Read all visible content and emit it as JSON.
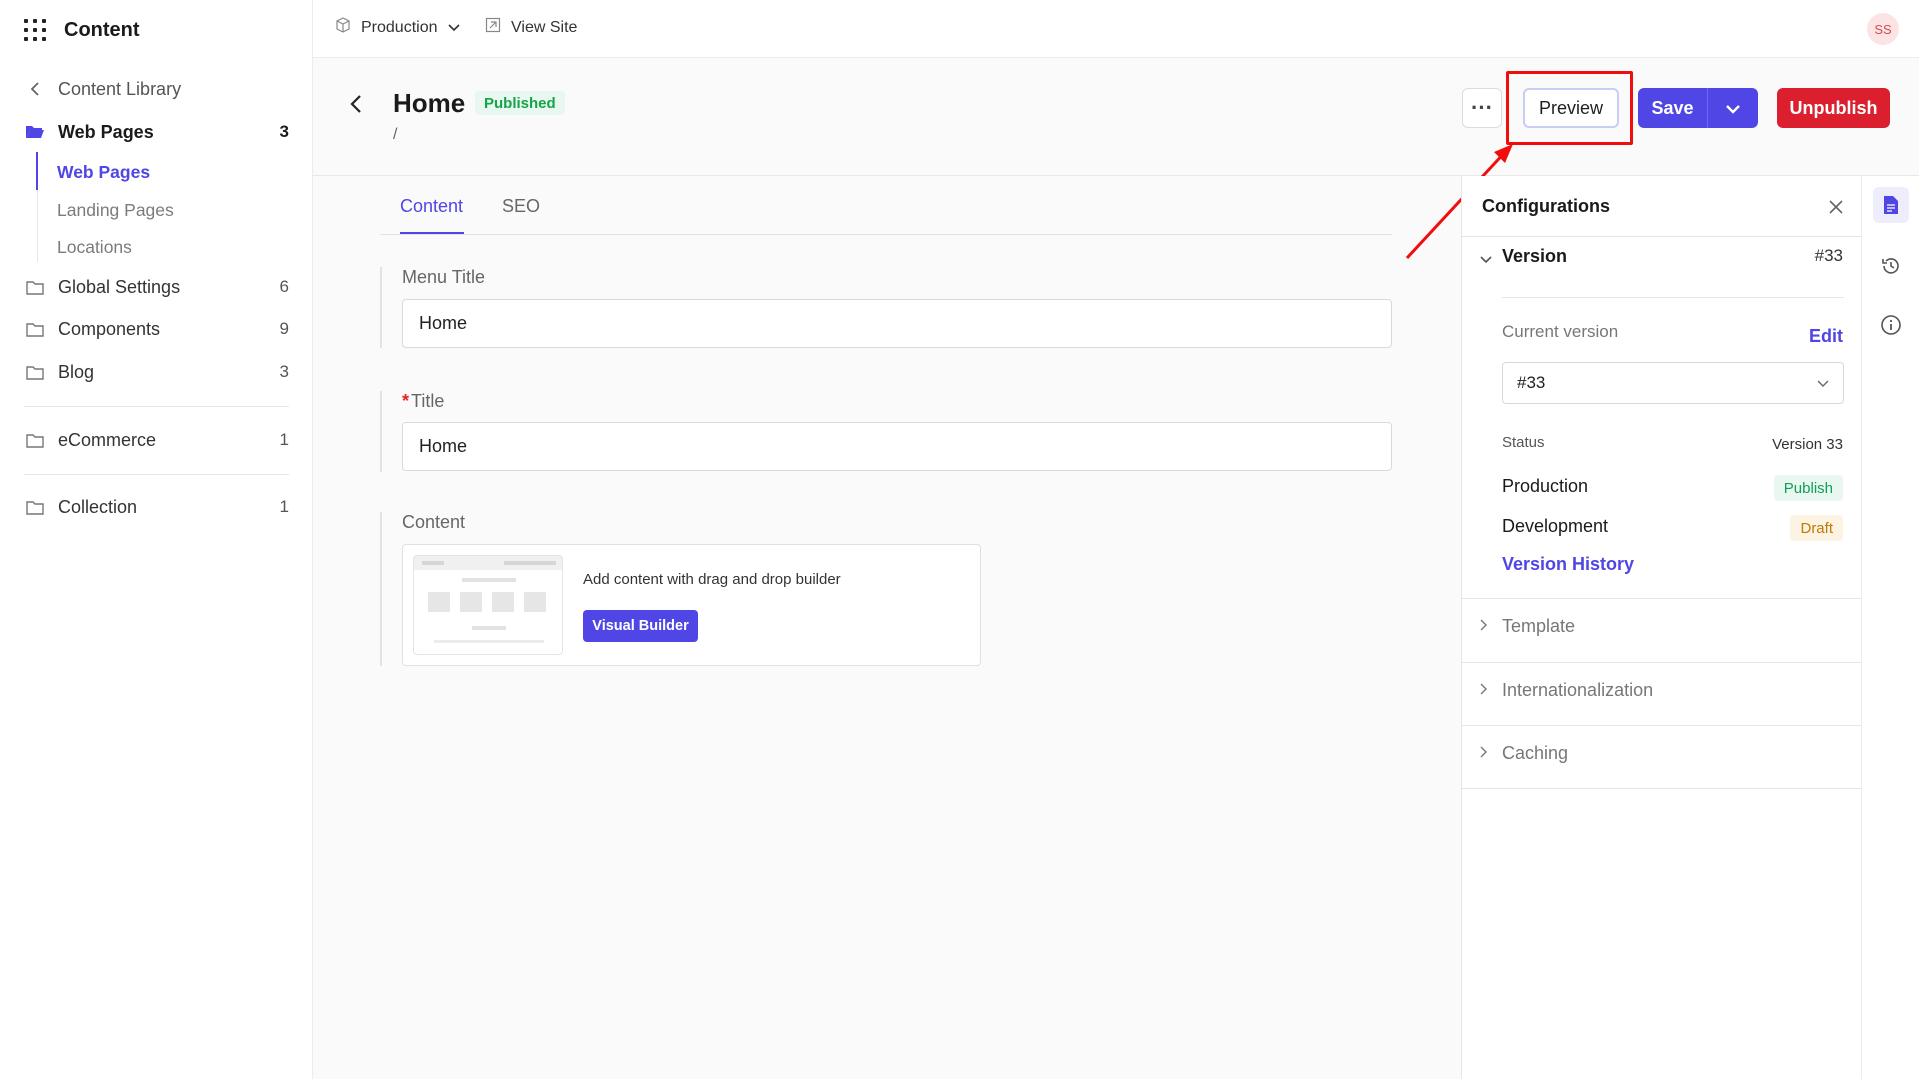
{
  "app": {
    "title": "Content"
  },
  "topbar": {
    "environment": "Production",
    "view_site": "View Site",
    "avatar": "SS"
  },
  "sidebar": {
    "back_label": "Content Library",
    "items": [
      {
        "label": "Web Pages",
        "count": "3"
      },
      {
        "label": "Global Settings",
        "count": "6"
      },
      {
        "label": "Components",
        "count": "9"
      },
      {
        "label": "Blog",
        "count": "3"
      },
      {
        "label": "eCommerce",
        "count": "1"
      },
      {
        "label": "Collection",
        "count": "1"
      }
    ],
    "subitems": [
      "Web Pages",
      "Landing Pages",
      "Locations"
    ]
  },
  "header": {
    "title": "Home",
    "status": "Published",
    "slug": "/",
    "more": "···",
    "preview": "Preview",
    "save": "Save",
    "unpublish": "Unpublish"
  },
  "tabs": [
    "Content",
    "SEO"
  ],
  "form": {
    "menu_title_label": "Menu Title",
    "menu_title_value": "Home",
    "title_required": "*",
    "title_label": "Title",
    "title_value": "Home",
    "content_label": "Content",
    "builder_text": "Add content with drag and drop builder",
    "builder_button": "Visual Builder"
  },
  "config": {
    "title": "Configurations",
    "version_label": "Version",
    "version_number": "#33",
    "current_version_label": "Current version",
    "edit": "Edit",
    "selected_version": "#33",
    "status_label": "Status",
    "status_value": "Version 33",
    "env_rows": [
      {
        "env": "Production",
        "state": "Publish"
      },
      {
        "env": "Development",
        "state": "Draft"
      }
    ],
    "version_history": "Version History",
    "sections": [
      "Template",
      "Internationalization",
      "Caching"
    ]
  },
  "colors": {
    "accent": "#4f46e5",
    "danger": "#dc1f2e",
    "highlight": "#f20d0d",
    "success": "#16a34a"
  }
}
